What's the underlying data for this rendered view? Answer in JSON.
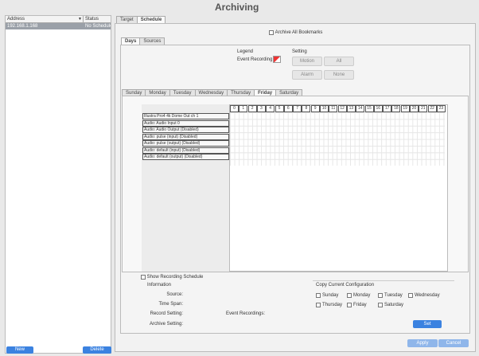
{
  "page_title": "Archiving",
  "devices": {
    "columns": [
      "Address",
      "Status"
    ],
    "rows": [
      {
        "address": "192.168.1.168",
        "status": "No Schedule"
      }
    ]
  },
  "left_buttons": {
    "new": "New",
    "delete": "Delete"
  },
  "top_tabs": [
    "Target",
    "Schedule"
  ],
  "archive_all": "Archive All Bookmarks",
  "sub_tabs": [
    "Days",
    "Sources"
  ],
  "legend": {
    "title": "Legend",
    "item": "Event Recording"
  },
  "setting": {
    "title": "Setting",
    "buttons": [
      "Motion",
      "All",
      "Alarm",
      "None"
    ]
  },
  "day_tabs": [
    "Sunday",
    "Monday",
    "Tuesday",
    "Wednesday",
    "Thursday",
    "Friday",
    "Saturday"
  ],
  "active_day": "Friday",
  "hours": [
    "0",
    "1",
    "2",
    "3",
    "4",
    "5",
    "6",
    "7",
    "8",
    "9",
    "10",
    "11",
    "12",
    "13",
    "14",
    "15",
    "16",
    "17",
    "18",
    "19",
    "20",
    "21",
    "22",
    "23"
  ],
  "channels": [
    "Illustra Pro4 4k Dome Out ch 1",
    "Audio: Audio Input 0",
    "Audio: Audio Output (Disabled)",
    "Audio: pulse (input) (Disabled)",
    "Audio: pulse (output) (Disabled)",
    "Audio: default (input) (Disabled)",
    "Audio: default (output) (Disabled)"
  ],
  "show_recording": "Show Recording Schedule",
  "information": {
    "title": "Information",
    "source": "Source:",
    "time_span": "Time Span:",
    "record_setting": "Record Setting:",
    "archive_setting": "Archive Setting:",
    "event_recordings": "Event Recordings:"
  },
  "copy": {
    "title": "Copy Current Configuration",
    "days": [
      "Sunday",
      "Monday",
      "Tuesday",
      "Wednesday",
      "Thursday",
      "Friday",
      "Saturday"
    ],
    "set": "Set"
  },
  "footer": {
    "apply": "Apply",
    "cancel": "Cancel"
  },
  "colors": {
    "accent": "#3b82e0",
    "event_recording": "#e33333",
    "selected_row": "#9aa0a8"
  }
}
